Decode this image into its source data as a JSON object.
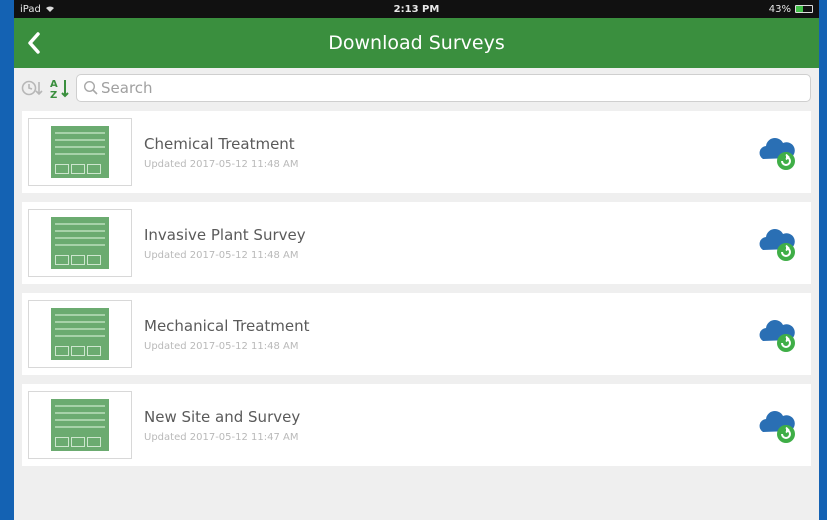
{
  "status_bar": {
    "device": "iPad",
    "time": "2:13 PM",
    "battery": "43%",
    "battery_level": 0.43
  },
  "nav": {
    "title": "Download Surveys"
  },
  "search": {
    "placeholder": "Search"
  },
  "surveys": [
    {
      "title": "Chemical Treatment",
      "updated": "Updated 2017-05-12 11:48 AM"
    },
    {
      "title": "Invasive Plant Survey",
      "updated": "Updated 2017-05-12 11:48 AM"
    },
    {
      "title": "Mechanical Treatment",
      "updated": "Updated 2017-05-12 11:48 AM"
    },
    {
      "title": "New Site and Survey",
      "updated": "Updated 2017-05-12 11:47 AM"
    }
  ],
  "colors": {
    "nav_green": "#3a8f3e",
    "cloud_blue": "#2a6fb4",
    "refresh_green": "#3fae47"
  }
}
